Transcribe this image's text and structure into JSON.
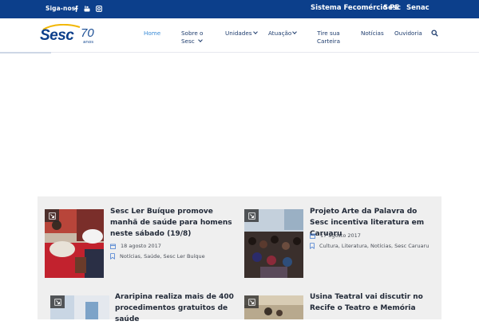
{
  "topbar": {
    "follow_label": "Siga-nos!",
    "social_icons": [
      "facebook-icon",
      "youtube-icon",
      "instagram-icon"
    ],
    "system_label": "Sistema Fecomércio PE",
    "brand_sesc": "Sesc",
    "brand_senac": "Senac"
  },
  "logo": {
    "brand": "Sesc",
    "years": "70",
    "anos": "anos"
  },
  "nav": {
    "items": [
      {
        "line1": "Home",
        "line2": "",
        "has_dropdown": false,
        "active": true
      },
      {
        "line1": "Sobre o",
        "line2": "Sesc",
        "has_dropdown": true,
        "active": false
      },
      {
        "line1": "Unidades",
        "line2": "",
        "has_dropdown": true,
        "active": false
      },
      {
        "line1": "Atuação",
        "line2": "",
        "has_dropdown": true,
        "active": false
      },
      {
        "line1": "Tire sua",
        "line2": "Carteira",
        "has_dropdown": false,
        "active": false
      },
      {
        "line1": "Notícias",
        "line2": "",
        "has_dropdown": false,
        "active": false
      },
      {
        "line1": "Ouvidoria",
        "line2": "",
        "has_dropdown": false,
        "active": false
      }
    ],
    "search_icon": "search-icon"
  },
  "posts": [
    {
      "title": "Sesc Ler Buíque promove manhã de saúde para homens neste sábado (19/8)",
      "date": "18 agosto 2017",
      "tags": "Notícias, Saúde, Sesc Ler Buíque"
    },
    {
      "title": "Projeto Arte da Palavra do Sesc incentiva literatura em Caruaru",
      "date": "17 agosto 2017",
      "tags": "Cultura, Literatura, Notícias, Sesc Caruaru"
    },
    {
      "title": "Araripina realiza mais de 400 procedimentos gratuitos de saúde",
      "date": "",
      "tags": ""
    },
    {
      "title": "Usina Teatral vai discutir no Recife o Teatro e Memória",
      "date": "",
      "tags": ""
    }
  ],
  "colors": {
    "topbar": "#0c3f8b",
    "nav_text": "#1f3d6e",
    "nav_active": "#3a8bd6",
    "meta_icon": "#4a7fd1",
    "panel_bg": "#efefef"
  }
}
